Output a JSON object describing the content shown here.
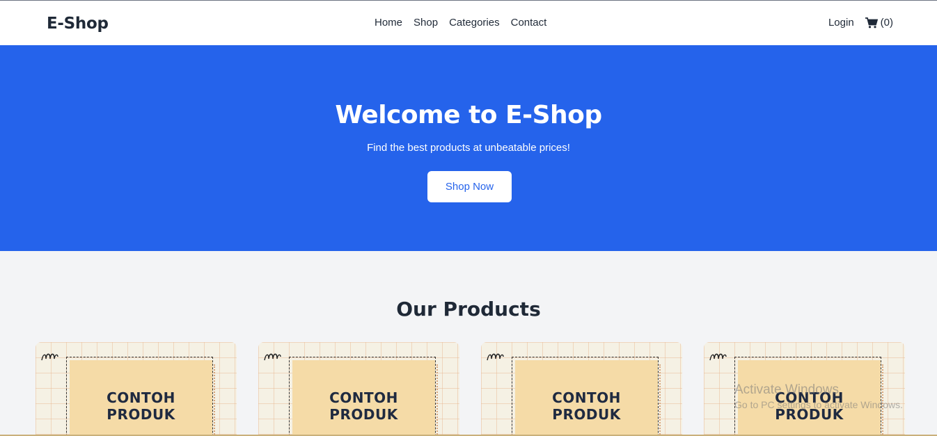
{
  "header": {
    "brand": "E-Shop",
    "nav": [
      "Home",
      "Shop",
      "Categories",
      "Contact"
    ],
    "login": "Login",
    "cart_count": "(0)"
  },
  "hero": {
    "title": "Welcome to E-Shop",
    "subtitle": "Find the best products at unbeatable prices!",
    "button": "Shop Now"
  },
  "products": {
    "title": "Our Products",
    "items": [
      {
        "line1": "CONTOH",
        "line2": "PRODUK"
      },
      {
        "line1": "CONTOH",
        "line2": "PRODUK"
      },
      {
        "line1": "CONTOH",
        "line2": "PRODUK"
      },
      {
        "line1": "CONTOH",
        "line2": "PRODUK"
      }
    ]
  },
  "watermark": {
    "line1": "Activate Windows",
    "line2": "Go to PC settings to activate Windows."
  },
  "colors": {
    "primary": "#2563eb",
    "background": "#f3f4f6",
    "text": "#1f2937",
    "card_inner": "#f5dba7"
  },
  "icons": {
    "cart": "shopping-cart-icon"
  }
}
